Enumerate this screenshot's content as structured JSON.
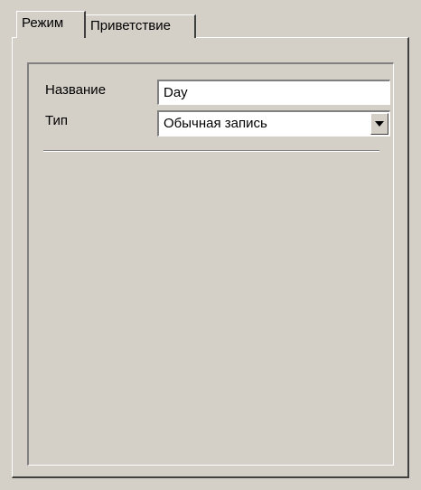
{
  "tabs": [
    {
      "label": "Режим",
      "active": true
    },
    {
      "label": "Приветствие",
      "active": false
    }
  ],
  "form": {
    "name_label": "Название",
    "name_value": "Day",
    "type_label": "Тип",
    "type_value": "Обычная запись"
  },
  "icons": {
    "dropdown": "chevron-down-icon"
  },
  "colors": {
    "face": "#d4d0c8",
    "shadow": "#808080",
    "dark_shadow": "#404040",
    "highlight": "#ffffff",
    "field_bg": "#ffffff"
  }
}
